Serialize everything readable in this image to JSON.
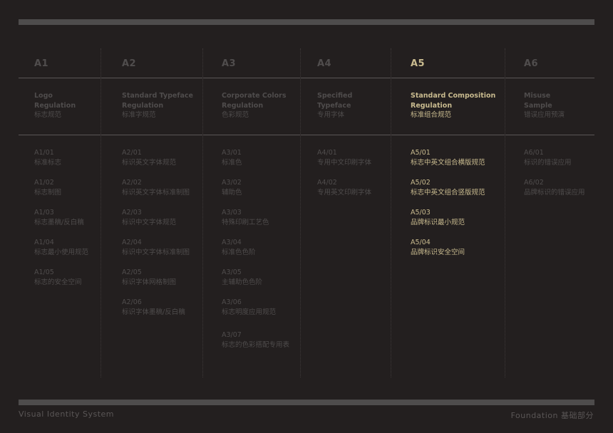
{
  "columns": [
    {
      "code": "A1",
      "title_en": [
        "Logo",
        "Regulation"
      ],
      "title_cn": "标志规范",
      "active": false,
      "items": [
        {
          "code": "A1/01",
          "cn": "标准标志"
        },
        {
          "code": "A1/02",
          "cn": "标志制图"
        },
        {
          "code": "A1/03",
          "cn": "标志墨稿/反白稿"
        },
        {
          "code": "A1/04",
          "cn": "标志最小使用规范"
        },
        {
          "code": "A1/05",
          "cn": "标志的安全空间"
        }
      ]
    },
    {
      "code": "A2",
      "title_en": [
        "Standard Typeface",
        "Regulation"
      ],
      "title_cn": "标准字规范",
      "active": false,
      "items": [
        {
          "code": "A2/01",
          "cn": "标识英文字体规范"
        },
        {
          "code": "A2/02",
          "cn": "标识英文字体标准制图"
        },
        {
          "code": "A2/03",
          "cn": "标识中文字体规范"
        },
        {
          "code": "A2/04",
          "cn": "标识中文字体标准制图"
        },
        {
          "code": "A2/05",
          "cn": "标识字体网格制图"
        },
        {
          "code": "A2/06",
          "cn": "标识字体墨稿/反白稿"
        }
      ]
    },
    {
      "code": "A3",
      "title_en": [
        "Corporate Colors",
        "Regulation"
      ],
      "title_cn": "色彩规范",
      "active": false,
      "items": [
        {
          "code": "A3/01",
          "cn": "标准色"
        },
        {
          "code": "A3/02",
          "cn": "辅助色"
        },
        {
          "code": "A3/03",
          "cn": "特殊印刷工艺色"
        },
        {
          "code": "A3/04",
          "cn": "标准色色阶"
        },
        {
          "code": "A3/05",
          "cn": "主辅助色色阶"
        },
        {
          "code": "A3/06",
          "cn": "标志明度应用规范"
        },
        {
          "code": "A3/07",
          "cn": "标志的色彩搭配专用表"
        }
      ]
    },
    {
      "code": "A4",
      "title_en": [
        "Specified",
        "Typeface"
      ],
      "title_cn": "专用字体",
      "active": false,
      "items": [
        {
          "code": "A4/01",
          "cn": "专用中文印刷字体"
        },
        {
          "code": "A4/02",
          "cn": "专用英文印刷字体"
        }
      ]
    },
    {
      "code": "A5",
      "title_en": [
        "Standard Composition",
        "Regulation"
      ],
      "title_cn": "标准组合规范",
      "active": true,
      "items": [
        {
          "code": "A5/01",
          "cn": "标志中英文组合横版规范"
        },
        {
          "code": "A5/02",
          "cn": "标志中英文组合竖版规范"
        },
        {
          "code": "A5/03",
          "cn": "品牌标识最小规范"
        },
        {
          "code": "A5/04",
          "cn": "品牌标识安全空间"
        }
      ]
    },
    {
      "code": "A6",
      "title_en": [
        "Misuse",
        "Sample"
      ],
      "title_cn": "错误应用预演",
      "active": false,
      "items": [
        {
          "code": "A6/01",
          "cn": "标识的错误应用"
        },
        {
          "code": "A6/02",
          "cn": "品牌标识的错误应用"
        }
      ]
    }
  ],
  "footer": {
    "left": "Visual Identity System",
    "right": "Foundation 基础部分"
  }
}
